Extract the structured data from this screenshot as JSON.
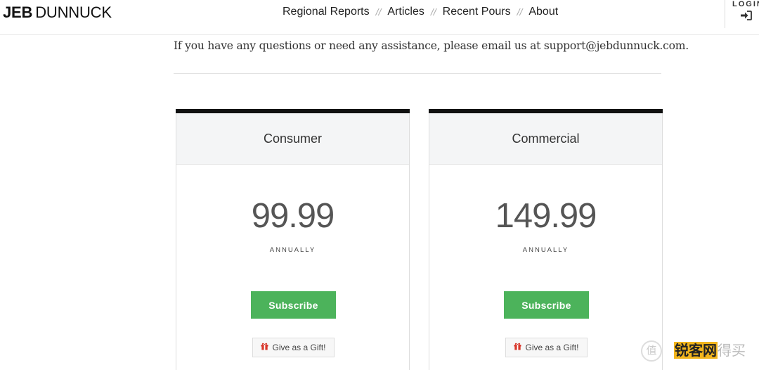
{
  "header": {
    "logo_bold": "JEB",
    "logo_light": "DUNNUCK",
    "nav": [
      "Regional Reports",
      "Articles",
      "Recent Pours",
      "About"
    ],
    "nav_separator": "//",
    "login_label": "LOGIN",
    "login_icon": "sign-in-icon"
  },
  "intro": {
    "text": "If you have any questions or need any assistance, please email us at support@jebdunnuck.com."
  },
  "plans": [
    {
      "name": "Consumer",
      "price": "99.99",
      "period": "ANNUALLY",
      "subscribe_label": "Subscribe",
      "gift_label": "Give as a Gift!"
    },
    {
      "name": "Commercial",
      "price": "149.99",
      "period": "ANNUALLY",
      "subscribe_label": "Subscribe",
      "gift_label": "Give as a Gift!"
    }
  ],
  "watermark": {
    "circle_char": "值",
    "text_highlight": "锐客网",
    "text_faded": "得买"
  },
  "colors": {
    "accent_green": "#4cb35b",
    "top_bar": "#111111",
    "gift_icon": "#d9382c"
  }
}
